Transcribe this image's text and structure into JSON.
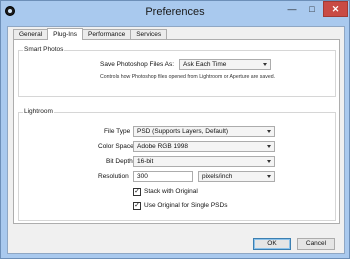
{
  "window": {
    "title": "Preferences",
    "minimize_glyph": "—",
    "maximize_glyph": "□",
    "close_glyph": "✕",
    "icon": "app-icon"
  },
  "tabs": [
    "General",
    "Plug-Ins",
    "Performance",
    "Services"
  ],
  "active_tab": "Plug-Ins",
  "smart_photos": {
    "title": "Smart Photos",
    "save_label": "Save Photoshop Files As:",
    "save_value": "Ask Each Time",
    "note": "Controls how Photoshop files opened from Lightroom or Aperture are saved."
  },
  "lightroom": {
    "title": "Lightroom",
    "file_type_label": "File Type",
    "file_type_value": "PSD (Supports Layers, Default)",
    "color_space_label": "Color Space",
    "color_space_value": "Adobe RGB 1998",
    "bit_depth_label": "Bit Depth",
    "bit_depth_value": "16-bit",
    "resolution_label": "Resolution",
    "resolution_value": "300",
    "resolution_unit": "pixels/inch",
    "stack_label": "Stack with Original",
    "stack_checked": true,
    "use_original_label": "Use Original for Single PSDs",
    "use_original_checked": true,
    "check_glyph": "✓"
  },
  "buttons": {
    "ok": "OK",
    "cancel": "Cancel"
  },
  "colors": {
    "titlebar": "#a9c9ee",
    "close": "#c94b45",
    "panel": "#ffffff"
  }
}
